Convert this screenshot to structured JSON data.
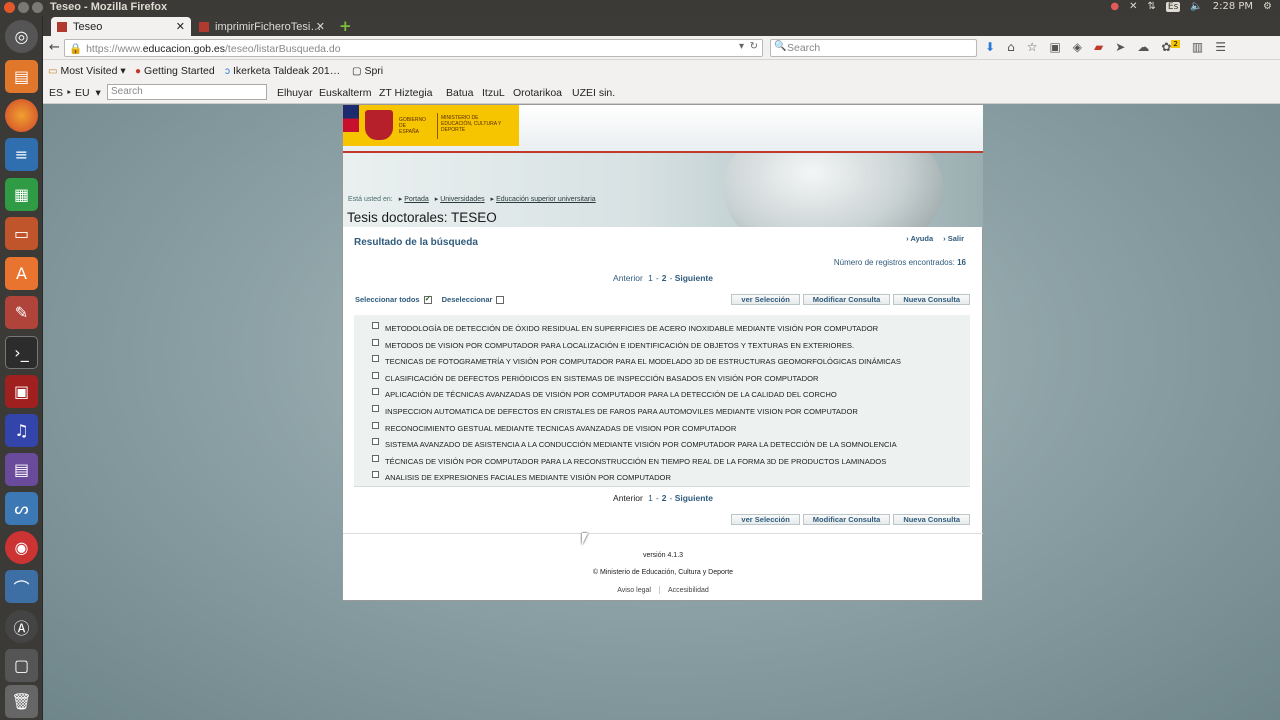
{
  "system": {
    "window_title": "Teseo - Mozilla Firefox",
    "keyboard_layout": "Es",
    "clock": "2:28 PM"
  },
  "browser": {
    "tabs": [
      {
        "label": "Teseo",
        "active": true
      },
      {
        "label": "imprimirFicheroTesi…",
        "active": false
      }
    ],
    "url_prefix": "https://www.",
    "url_domain": "educacion.gob.es",
    "url_path": "/teseo/listarBusqueda.do",
    "search_placeholder": "Search",
    "bookmarks": [
      "Most Visited",
      "Getting Started",
      "Ikerketa Taldeak 201…",
      "Spri"
    ],
    "addon_bar": {
      "lang": "ES ‣ EU",
      "search_placeholder": "Search",
      "links": [
        "Elhuyar",
        "Euskalterm",
        "ZT Hiztegia",
        "Batua",
        "ItzuL",
        "Orotarikoa",
        "UZEI sin."
      ]
    },
    "download_badge": "2"
  },
  "gov_header": {
    "gobierno": "GOBIERNO DE ESPAÑA",
    "ministerio": "MINISTERIO DE EDUCACIÓN, CULTURA Y DEPORTE"
  },
  "breadcrumb": {
    "prefix": "Está usted en:",
    "items": [
      "Portada",
      "Universidades",
      "Educación superior universitaria"
    ]
  },
  "page_title": "Tesis doctorales: TESEO",
  "results": {
    "heading": "Resultado de la búsqueda",
    "help": "Ayuda",
    "exit": "Salir",
    "count_label": "Número de registros encontrados:",
    "count_value": "16",
    "pager": {
      "prev": "Anterior",
      "pages": [
        "1",
        "2"
      ],
      "sep": "-",
      "next": "Siguiente"
    },
    "select_all": "Seleccionar todos",
    "deselect": "Deseleccionar",
    "buttons": [
      "ver Selección",
      "Modificar Consulta",
      "Nueva Consulta"
    ],
    "items": [
      "METODOLOGÍA DE DETECCIÓN DE ÓXIDO RESIDUAL EN SUPERFICIES DE ACERO INOXIDABLE MEDIANTE VISIÓN POR COMPUTADOR",
      "METODOS DE VISION POR COMPUTADOR PARA LOCALIZACIÓN E IDENTIFICACIÓN DE OBJETOS Y TEXTURAS EN EXTERIORES.",
      "TECNICAS DE FOTOGRAMETRÍA Y VISIÓN POR COMPUTADOR PARA EL MODELADO 3D DE ESTRUCTURAS GEOMORFOLÓGICAS DINÁMICAS",
      "CLASIFICACIÓN DE DEFECTOS PERIÓDICOS EN SISTEMAS DE INSPECCIÓN BASADOS EN VISIÓN POR COMPUTADOR",
      "APLICACIÓN DE TÉCNICAS AVANZADAS DE VISIÓN POR COMPUTADOR PARA LA DETECCIÓN DE LA CALIDAD DEL CORCHO",
      "INSPECCION AUTOMATICA DE DEFECTOS EN CRISTALES DE FAROS PARA AUTOMOVILES MEDIANTE VISION POR COMPUTADOR",
      "RECONOCIMIENTO GESTUAL MEDIANTE TECNICAS AVANZADAS DE VISION POR COMPUTADOR",
      "SISTEMA AVANZADO DE ASISTENCIA A LA CONDUCCIÓN MEDIANTE VISIÓN POR COMPUTADOR PARA LA DETECCIÓN DE LA SOMNOLENCIA",
      "TÉCNICAS DE VISIÓN POR COMPUTADOR PARA LA RECONSTRUCCIÓN EN TIEMPO REAL DE LA FORMA 3D DE PRODUCTOS LAMINADOS",
      "ANALISIS DE EXPRESIONES FACIALES MEDIANTE VISIÓN POR COMPUTADOR"
    ]
  },
  "footer": {
    "version": "versión 4.1.3",
    "copyright": "© Ministerio de Educación, Cultura y Deporte",
    "links": [
      "Aviso legal",
      "Accesibilidad"
    ]
  },
  "launcher_icons": [
    "ubuntu-dash-icon",
    "files-icon",
    "firefox-icon",
    "writer-icon",
    "calc-icon",
    "impress-icon",
    "software-center-icon",
    "settings-icon",
    "terminal-icon",
    "app-icon",
    "audio-icon",
    "media-icon",
    "python-icon",
    "app2-icon",
    "app3-icon",
    "updater-icon",
    "workspaces-icon",
    "trash-icon"
  ]
}
